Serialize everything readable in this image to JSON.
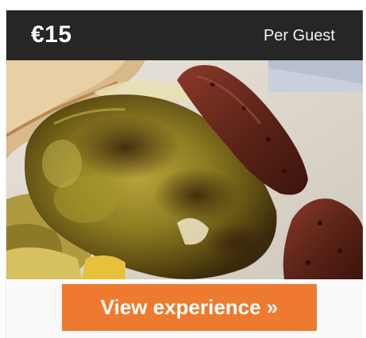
{
  "offer": {
    "price": "€15",
    "unit": "Per Guest"
  },
  "photo": {
    "subject": "roasted-pepper-and-sausage-photo"
  },
  "cta": {
    "label": "View experience »"
  },
  "colors": {
    "header_bg": "#262626",
    "button_bg": "#ee7a2f",
    "button_text": "#ffffff"
  }
}
